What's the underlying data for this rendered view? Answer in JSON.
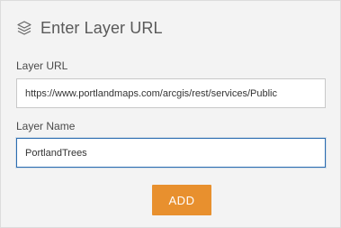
{
  "panel": {
    "title": "Enter Layer URL",
    "title_icon": "layers-icon"
  },
  "fields": {
    "url": {
      "label": "Layer URL",
      "value": "https://www.portlandmaps.com/arcgis/rest/services/Public"
    },
    "name": {
      "label": "Layer Name",
      "value": "PortlandTrees"
    }
  },
  "actions": {
    "add_label": "ADD"
  },
  "colors": {
    "accent": "#e8902e",
    "focus_border": "#2b6cb0",
    "panel_bg": "#f3f3f3"
  }
}
